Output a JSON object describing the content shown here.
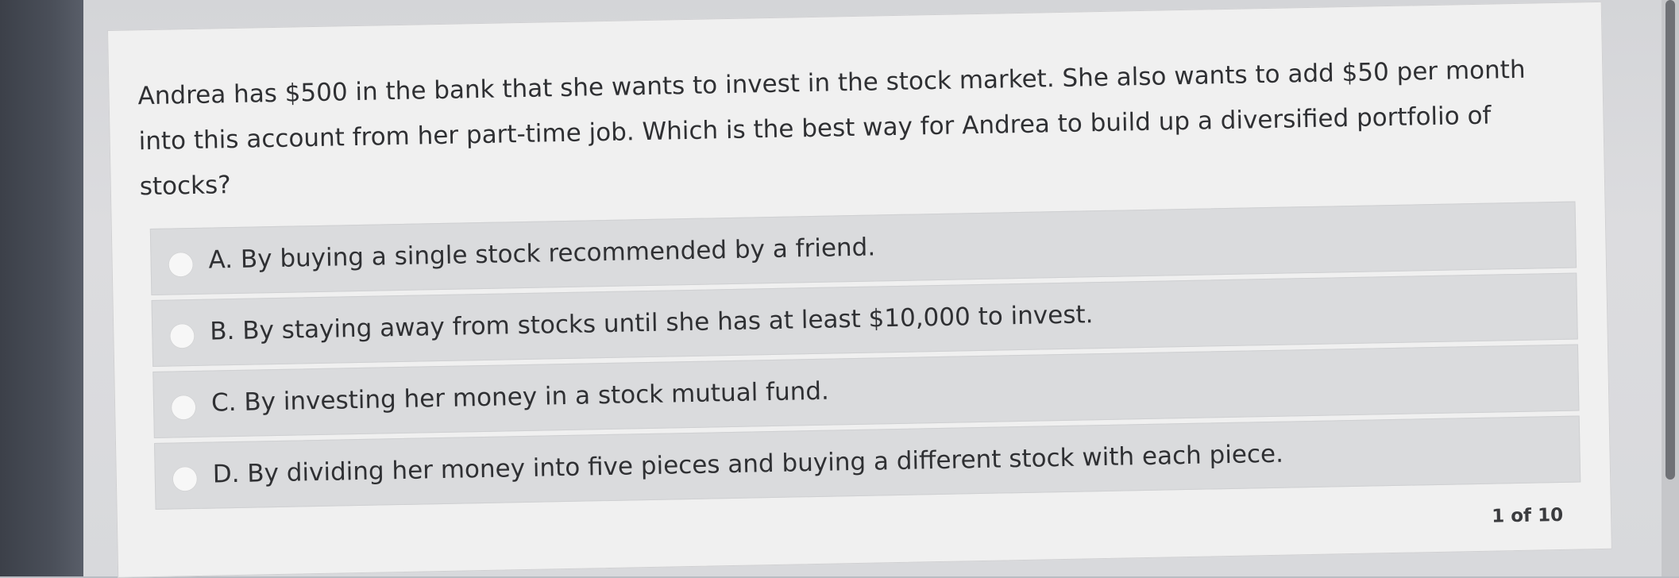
{
  "question": {
    "text": "Andrea has $500 in the bank that she wants to invest in the stock market. She also wants to add $50 per month into this account from her part-time job. Which is the best way for Andrea to build up a diversified portfolio of stocks?"
  },
  "options": [
    {
      "label": "A. By buying a single stock recommended by a friend."
    },
    {
      "label": "B. By staying away from stocks until she has at least $10,000 to invest."
    },
    {
      "label": "C. By investing her money in a stock mutual fund."
    },
    {
      "label": "D. By dividing her money into five pieces and buying a different stock with each piece."
    }
  ],
  "pager": {
    "text": "1 of 10"
  }
}
